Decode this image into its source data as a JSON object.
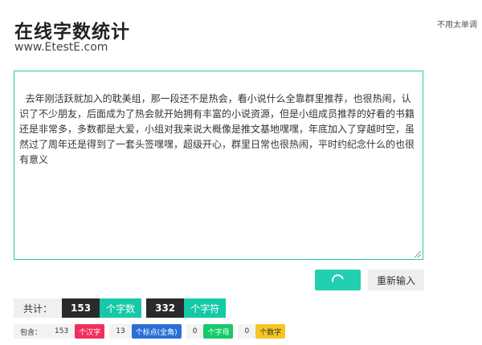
{
  "header": {
    "title": "在线字数统计",
    "site": "www.EtestE.com",
    "corner_note": "不用太单调"
  },
  "editor": {
    "text": "去年刚活跃就加入的耽美组，那一段还不是热会，看小说什么全靠群里推荐，也很热闹，认识了不少朋友，后面成为了热会就开始拥有丰富的小说资源，但是小组成员推荐的好看的书籍还是非常多，多数都是大爱，小组对我来说大概像是推文基地嘿嘿，年底加入了穿越时空，虽然过了周年还是得到了一套头签嘿嘿，超级开心，群里日常也很热闹，平时约纪念什么的也很有意义"
  },
  "actions": {
    "reset_label": "重新输入"
  },
  "totals": {
    "label": "共计：",
    "char_count": "153",
    "char_unit": "个字数",
    "symbol_count": "332",
    "symbol_unit": "个字符"
  },
  "details": {
    "label": "包含：",
    "items": [
      {
        "count": "153",
        "unit": "个汉字",
        "color": "#f0305a"
      },
      {
        "count": "13",
        "unit": "个标点(全角)",
        "color": "#2a6fd6"
      },
      {
        "count": "0",
        "unit": "个字母",
        "color": "#16c96a"
      },
      {
        "count": "0",
        "unit": "个数字",
        "color": "#f5c623"
      }
    ]
  }
}
